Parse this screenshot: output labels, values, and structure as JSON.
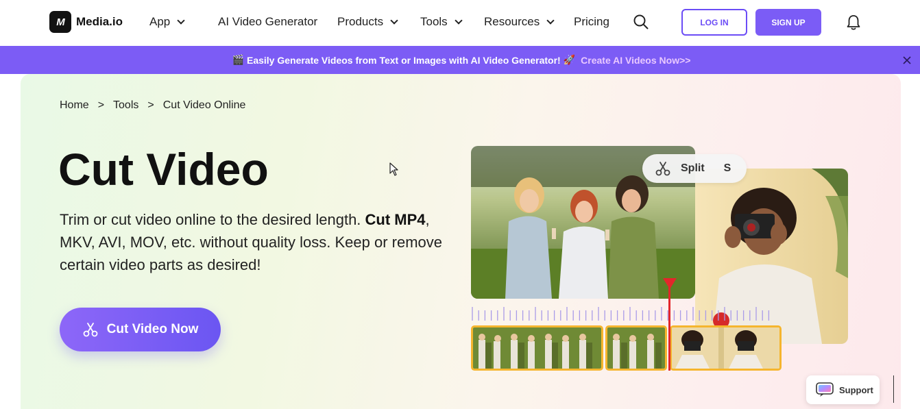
{
  "brand": {
    "name": "Media.io",
    "mark": "M"
  },
  "nav": {
    "items": [
      {
        "label": "App",
        "dropdown": true
      },
      {
        "label": "AI Video Generator",
        "dropdown": false
      },
      {
        "label": "Products",
        "dropdown": true
      },
      {
        "label": "Tools",
        "dropdown": true
      },
      {
        "label": "Resources",
        "dropdown": true
      },
      {
        "label": "Pricing",
        "dropdown": false
      }
    ],
    "login": "LOG IN",
    "signup": "SIGN UP"
  },
  "banner": {
    "emoji_left": "🎬",
    "text": "Easily Generate Videos from Text or Images with AI Video Generator!",
    "emoji_right": "🚀",
    "cta": "Create AI Videos Now>>"
  },
  "breadcrumb": {
    "home": "Home",
    "sep": ">",
    "tools": "Tools",
    "current": "Cut Video Online"
  },
  "hero": {
    "title": "Cut Video",
    "desc_pre": "Trim or cut video online to the desired length.",
    "desc_bold": "Cut MP4",
    "desc_post": ", MKV, AVI, MOV, etc. without quality loss. Keep or remove certain video parts as desired!",
    "cta": "Cut Video Now"
  },
  "editor": {
    "split_label": "Split",
    "split_key": "S"
  },
  "support": {
    "label": "Support"
  },
  "colors": {
    "accent": "#7b5cf6",
    "banner": "#7c5cf5",
    "clip_border": "#f5b52e",
    "playhead": "#e3262b"
  }
}
